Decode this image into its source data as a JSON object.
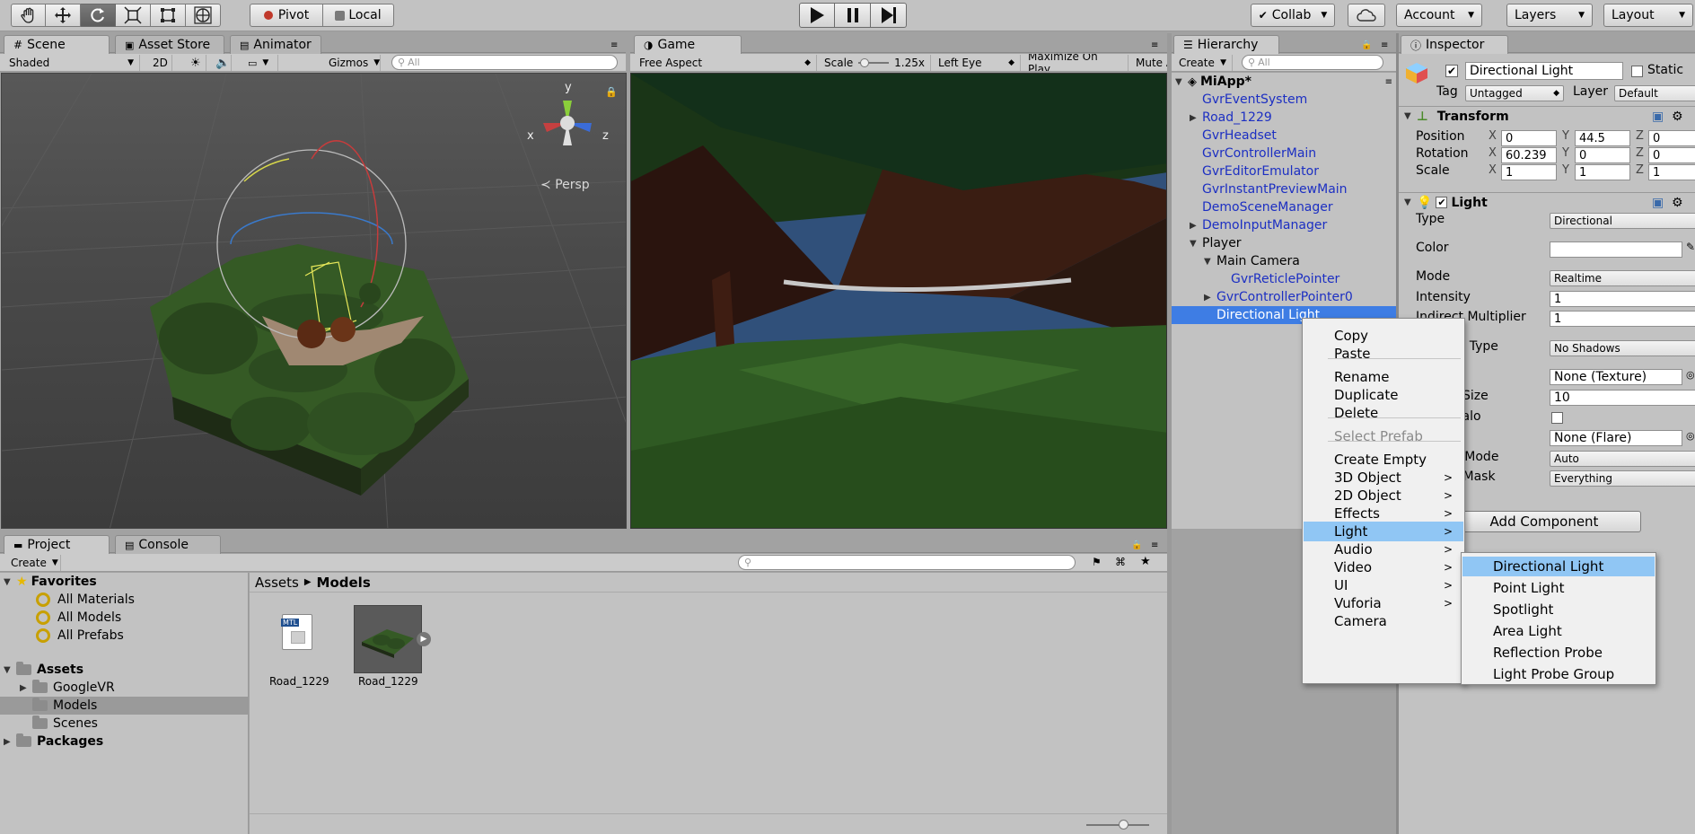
{
  "toolbar": {
    "tool_icons": [
      "hand-icon",
      "move-icon",
      "rotate-icon",
      "scale-icon",
      "rect-tool-icon",
      "transform-tool-icon"
    ],
    "pivot": "Pivot",
    "local": "Local",
    "collab": "Collab",
    "account": "Account",
    "layers": "Layers",
    "layout": "Layout"
  },
  "scene_panel": {
    "tabs": [
      "Scene",
      "Asset Store",
      "Animator"
    ],
    "shading": "Shaded",
    "mode_2d": "2D",
    "gizmos": "Gizmos",
    "search_placeholder": "All",
    "persp": "Persp",
    "axis_x": "x",
    "axis_y": "y",
    "axis_z": "z"
  },
  "game_panel": {
    "tab": "Game",
    "aspect": "Free Aspect",
    "scale_label": "Scale",
    "scale_value": "1.25x",
    "eye": "Left Eye",
    "maximize": "Maximize On Play",
    "mute": "Mute A"
  },
  "hierarchy": {
    "tab": "Hierarchy",
    "create": "Create",
    "search_placeholder": "All",
    "scene_name": "MiApp*",
    "items": [
      {
        "label": "GvrEventSystem",
        "indent": 0,
        "foldout": false,
        "blue": true
      },
      {
        "label": "Road_1229",
        "indent": 0,
        "foldout": true,
        "blue": true
      },
      {
        "label": "GvrHeadset",
        "indent": 0,
        "foldout": false,
        "blue": true
      },
      {
        "label": "GvrControllerMain",
        "indent": 0,
        "foldout": false,
        "blue": true
      },
      {
        "label": "GvrEditorEmulator",
        "indent": 0,
        "foldout": false,
        "blue": true
      },
      {
        "label": "GvrInstantPreviewMain",
        "indent": 0,
        "foldout": false,
        "blue": true
      },
      {
        "label": "DemoSceneManager",
        "indent": 0,
        "foldout": false,
        "blue": true
      },
      {
        "label": "DemoInputManager",
        "indent": 0,
        "foldout": true,
        "blue": true
      },
      {
        "label": "Player",
        "indent": 0,
        "foldout": true,
        "blue": false
      },
      {
        "label": "Main Camera",
        "indent": 1,
        "foldout": true,
        "blue": false
      },
      {
        "label": "GvrReticlePointer",
        "indent": 2,
        "foldout": false,
        "blue": true
      },
      {
        "label": "GvrControllerPointer0",
        "indent": 1,
        "foldout": true,
        "blue": true
      },
      {
        "label": "Directional Light",
        "indent": 1,
        "foldout": false,
        "blue": false,
        "selected": true
      }
    ]
  },
  "context_menu": {
    "items": [
      "Copy",
      "Paste",
      "Rename",
      "Duplicate",
      "Delete",
      "Select Prefab",
      "Create Empty",
      "3D Object",
      "2D Object",
      "Effects",
      "Light",
      "Audio",
      "Video",
      "UI",
      "Vuforia",
      "Camera"
    ],
    "submenu": [
      "Directional Light",
      "Point Light",
      "Spotlight",
      "Area Light",
      "Reflection Probe",
      "Light Probe Group"
    ]
  },
  "inspector": {
    "tab": "Inspector",
    "object_name": "Directional Light",
    "static": "Static",
    "tag_label": "Tag",
    "tag": "Untagged",
    "layer_label": "Layer",
    "layer": "Default",
    "transform": {
      "title": "Transform",
      "position_label": "Position",
      "rotation_label": "Rotation",
      "scale_label": "Scale",
      "position": [
        "0",
        "44.5",
        "0"
      ],
      "rotation": [
        "60.239",
        "0",
        "0"
      ],
      "scale": [
        "1",
        "1",
        "1"
      ]
    },
    "light": {
      "title": "Light",
      "type_label": "Type",
      "type": "Directional",
      "color_label": "Color",
      "mode_label": "Mode",
      "mode": "Realtime",
      "intensity_label": "Intensity",
      "intensity": "1",
      "indirect_label": "Indirect Multiplier",
      "indirect": "1",
      "shadow_type_label": "Shadow Type",
      "shadow_type": "No Shadows",
      "cookie": "None (Texture)",
      "cookie_size_label": "Cookie Size",
      "cookie_size": "10",
      "halo_label": "Draw Halo",
      "flare": "None (Flare)",
      "render_mode_label": "Render Mode",
      "render_mode": "Auto",
      "culling_label": "Culling Mask",
      "culling": "Everything"
    },
    "add_component": "Add Component"
  },
  "project": {
    "tabs": [
      "Project",
      "Console"
    ],
    "create": "Create",
    "favorites": "Favorites",
    "favorite_items": [
      "All Materials",
      "All Models",
      "All Prefabs"
    ],
    "assets": "Assets",
    "asset_folders": [
      "GoogleVR",
      "Models",
      "Scenes"
    ],
    "packages": "Packages",
    "breadcrumb": [
      "Assets",
      "Models"
    ],
    "files": [
      "Road_1229",
      "Road_1229"
    ],
    "mtl_badge": "MTL"
  }
}
